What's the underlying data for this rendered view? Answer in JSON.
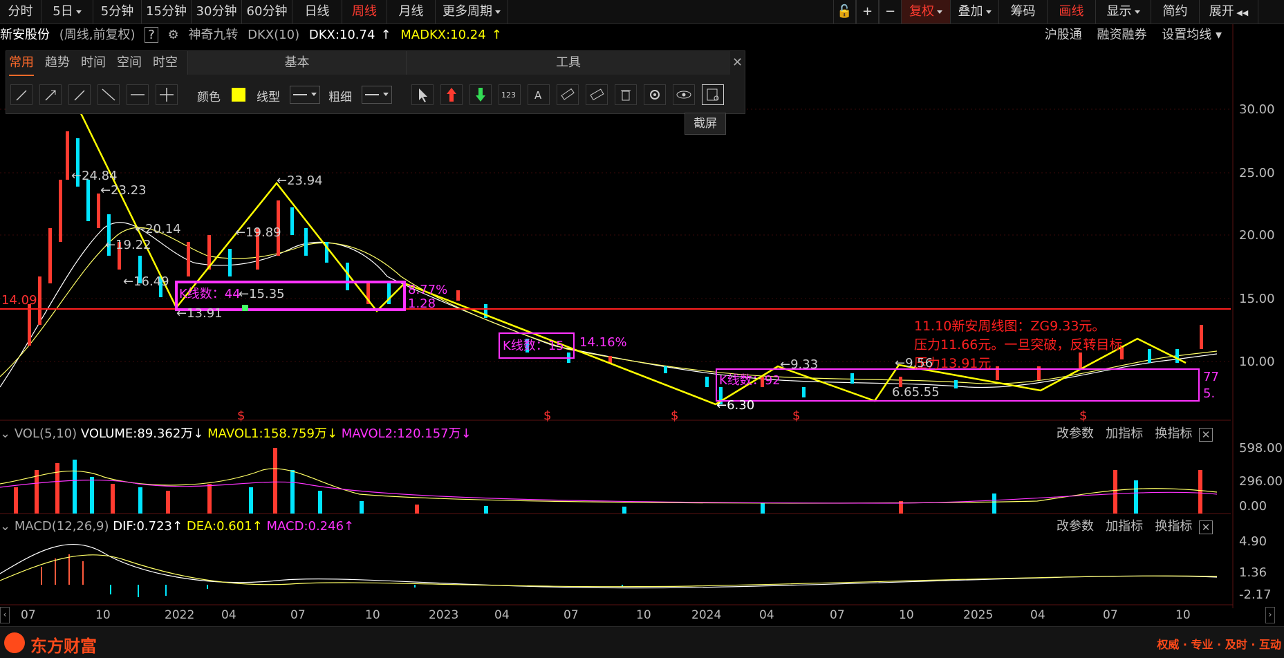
{
  "topbar": {
    "periods": [
      {
        "label": "分时",
        "active": false,
        "dropdown": false
      },
      {
        "label": "5日",
        "active": false,
        "dropdown": true
      },
      {
        "label": "5分钟",
        "active": false,
        "dropdown": false
      },
      {
        "label": "15分钟",
        "active": false,
        "dropdown": false
      },
      {
        "label": "30分钟",
        "active": false,
        "dropdown": false
      },
      {
        "label": "60分钟",
        "active": false,
        "dropdown": false
      },
      {
        "label": "日线",
        "active": false,
        "dropdown": false
      },
      {
        "label": "周线",
        "active": true,
        "dropdown": false
      },
      {
        "label": "月线",
        "active": false,
        "dropdown": false
      },
      {
        "label": "更多周期",
        "active": false,
        "dropdown": true
      }
    ],
    "right_buttons": [
      {
        "label": "复权",
        "color": "#ff3b30",
        "dropdown": true
      },
      {
        "label": "叠加",
        "color": "#d8d8d8",
        "dropdown": true
      },
      {
        "label": "筹码",
        "color": "#d8d8d8",
        "dropdown": false
      },
      {
        "label": "画线",
        "color": "#ff3b30",
        "dropdown": false
      },
      {
        "label": "显示",
        "color": "#d8d8d8",
        "dropdown": true
      },
      {
        "label": "简约",
        "color": "#d8d8d8",
        "dropdown": false
      },
      {
        "label": "展开",
        "color": "#d8d8d8",
        "dropdown": false
      }
    ]
  },
  "info": {
    "stock_name": "新安股份",
    "mode": "(周线,前复权)",
    "question": "?",
    "indicator": "神奇九转",
    "dkx_name": "DKX(10)",
    "dkx": "DKX:10.74",
    "madkx": "MADKX:10.24",
    "links": [
      "沪股通",
      "融资融券",
      "设置均线"
    ]
  },
  "drawpanel": {
    "tabs": [
      "常用",
      "趋势",
      "时间",
      "空间",
      "时空"
    ],
    "basic_title": "基本",
    "tools_title": "工具",
    "color_label": "颜色",
    "color_value": "#ffff00",
    "linetype_label": "线型",
    "thickness_label": "粗细",
    "tooltip": "截屏",
    "close": "✕"
  },
  "price_axis": [
    "30.00",
    "25.00",
    "20.00",
    "15.00",
    "10.00"
  ],
  "chart_text": {
    "hline_label": "14.09",
    "annotation_lines": [
      "11.10新安周线图：ZG9.33元。",
      "压力11.66元。一旦突破，反转目标",
      "压力13.91元"
    ],
    "points": [
      "←24.84",
      "←23.23",
      "←23.94",
      "←20.14",
      "←19.89",
      "←19.22",
      "←16.49",
      "←15.35",
      "←13.91",
      "←9.33",
      "←9.56",
      "←6.30",
      "6.65.55"
    ],
    "box1": "K线数：44",
    "box1_pct": "8.77%",
    "box1_low": "1.28",
    "box2": "K线数：15",
    "box2_pct": "14.16%",
    "box3": "K线数：92",
    "box3_r1": "77",
    "box3_r2": "5.",
    "s_marks": [
      "$",
      "$",
      "$",
      "$",
      "$"
    ]
  },
  "vol": {
    "title": "VOL(5,10)",
    "volume": "VOLUME:89.362万",
    "mavol1": "MAVOL1:158.759万",
    "mavol2": "MAVOL2:120.157万",
    "axis": [
      "598.00",
      "296.00",
      "0.00"
    ],
    "actions": [
      "改参数",
      "加指标",
      "换指标"
    ]
  },
  "macd": {
    "title": "MACD(12,26,9)",
    "dif": "DIF:0.723",
    "dea": "DEA:0.601",
    "macd": "MACD:0.246",
    "axis": [
      "4.90",
      "1.36",
      "-2.17"
    ],
    "actions": [
      "改参数",
      "加指标",
      "换指标"
    ]
  },
  "xaxis": [
    "07",
    "10",
    "2022",
    "04",
    "07",
    "10",
    "2023",
    "04",
    "07",
    "10",
    "2024",
    "04",
    "07",
    "10",
    "2025",
    "04",
    "07",
    "10"
  ],
  "footer": {
    "brand": "东方财富",
    "slogan": "权威 · 专业 · 及时 · 互动"
  }
}
